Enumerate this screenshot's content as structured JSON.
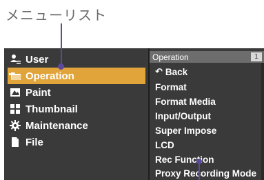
{
  "callout": {
    "label": "メニューリスト"
  },
  "menu": {
    "items": [
      {
        "label": "User",
        "icon": "user-icon",
        "selected": false
      },
      {
        "label": "Operation",
        "icon": "folder-open-icon",
        "selected": true
      },
      {
        "label": "Paint",
        "icon": "paint-icon",
        "selected": false
      },
      {
        "label": "Thumbnail",
        "icon": "thumbnail-icon",
        "selected": false
      },
      {
        "label": "Maintenance",
        "icon": "gear-icon",
        "selected": false
      },
      {
        "label": "File",
        "icon": "file-icon",
        "selected": false
      }
    ]
  },
  "submenu": {
    "header": "Operation",
    "page": "1",
    "items": [
      {
        "label": "Back",
        "icon": "back-arrow-icon"
      },
      {
        "label": "Format"
      },
      {
        "label": "Format Media"
      },
      {
        "label": "Input/Output"
      },
      {
        "label": "Super Impose"
      },
      {
        "label": "LCD"
      },
      {
        "label": "Rec Function"
      },
      {
        "label": "Proxy Recording Mode"
      }
    ]
  },
  "colors": {
    "screen_bg": "#3a3a3a",
    "selected_bg": "#e0a43a",
    "leader": "#5b4a9b",
    "header_bg": "#6d6d6d"
  }
}
